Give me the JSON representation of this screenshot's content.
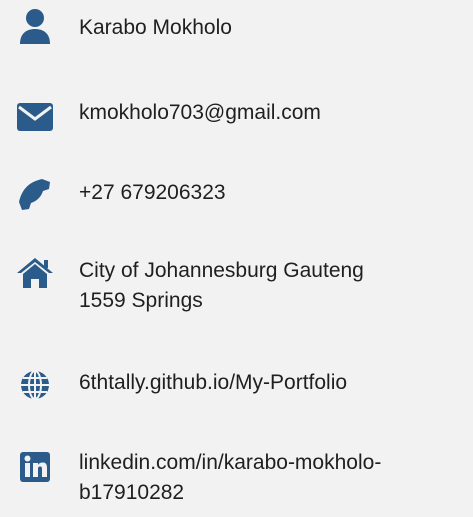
{
  "theme": {
    "icon_color": "#2b5b8a",
    "background": "#f2f2f2",
    "text_color": "#1f1f1f"
  },
  "contact": {
    "name": {
      "icon": "user-icon",
      "text": "Karabo Mokholo"
    },
    "email": {
      "icon": "envelope-icon",
      "text": "kmokholo703@gmail.com"
    },
    "phone": {
      "icon": "phone-icon",
      "text": "+27 679206323"
    },
    "address": {
      "icon": "home-icon",
      "line1": "City of Johannesburg Gauteng",
      "line2": "1559 Springs"
    },
    "website": {
      "icon": "globe-icon",
      "text": "6thtally.github.io/My-Portfolio"
    },
    "linkedin": {
      "icon": "linkedin-icon",
      "line1": "linkedin.com/in/karabo-mokholo-",
      "line2": "b17910282"
    }
  }
}
